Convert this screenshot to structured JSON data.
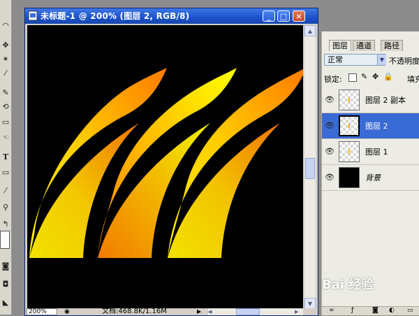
{
  "window": {
    "title": "未标题-1 @ 200% (图层 2, RGB/8)",
    "buttons": {
      "minimize": "_",
      "maximize": "□",
      "close": "×"
    }
  },
  "status": {
    "zoom": "200%",
    "doc_info": "文档:468.8K/1.16M"
  },
  "layers_panel": {
    "tabs": [
      "图层",
      "通道",
      "路径"
    ],
    "active_tab": 0,
    "blend_mode": "正常",
    "opacity_label": "不透明度",
    "lock_label": "锁定:",
    "fill_label": "填充",
    "layers": [
      {
        "name": "图层 2 副本",
        "selected": false,
        "thumb": "transparent"
      },
      {
        "name": "图层 2",
        "selected": true,
        "thumb": "transparent"
      },
      {
        "name": "图层 1",
        "selected": false,
        "thumb": "transparent"
      },
      {
        "name": "背景",
        "selected": false,
        "thumb": "black"
      }
    ]
  },
  "watermark": "Bai 经验",
  "colors": {
    "title_bar": "#1b52c9",
    "selected_layer": "#3a6ad3",
    "canvas_bg": "#000000",
    "shape_yellow": "#ffff00",
    "shape_orange": "#ff8a00"
  }
}
